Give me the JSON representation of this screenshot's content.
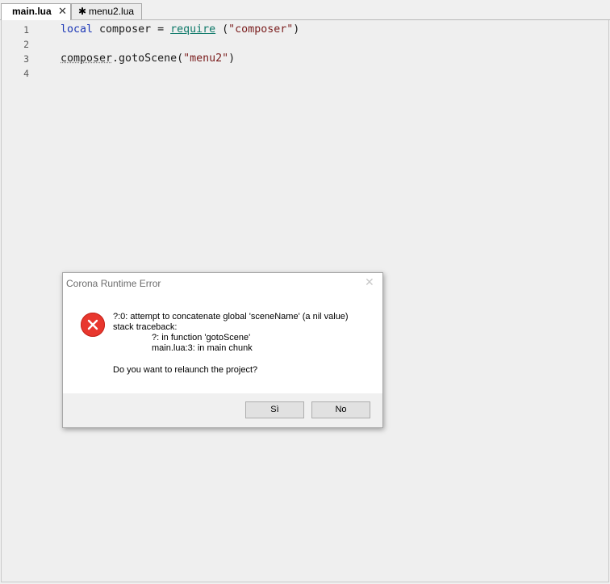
{
  "tabs": [
    {
      "label": "main.lua",
      "close": "✕"
    },
    {
      "label": "menu2.lua",
      "dirty": "✱"
    }
  ],
  "editor": {
    "lines": [
      {
        "number": "1",
        "parts": [
          {
            "text": "local",
            "style": "keyword"
          },
          {
            "text": " composer = ",
            "style": "plain"
          },
          {
            "text": "require",
            "style": "function"
          },
          {
            "text": " (",
            "style": "plain"
          },
          {
            "text": "\"composer\"",
            "style": "string"
          },
          {
            "text": ")",
            "style": "plain"
          }
        ]
      },
      {
        "number": "2",
        "parts": []
      },
      {
        "number": "3",
        "parts": [
          {
            "text": "composer",
            "style": "dotted"
          },
          {
            "text": ".gotoScene(",
            "style": "plain"
          },
          {
            "text": "\"menu2\"",
            "style": "string"
          },
          {
            "text": ")",
            "style": "plain"
          }
        ]
      },
      {
        "number": "4",
        "parts": []
      }
    ]
  },
  "dialog": {
    "title": "Corona Runtime Error",
    "close": "✕",
    "icon": "error-icon",
    "message_lines": [
      "?:0: attempt to concatenate global 'sceneName' (a nil value)",
      "stack traceback:",
      "?: in function 'gotoScene'",
      "main.lua:3: in main chunk"
    ],
    "question": "Do you want to relaunch the project?",
    "buttons": {
      "yes": "Sì",
      "no": "No"
    }
  },
  "colors": {
    "keyword": "#1c37b6",
    "function": "#0f7a6a",
    "string": "#7a1d1d",
    "error": "#e8372e"
  }
}
